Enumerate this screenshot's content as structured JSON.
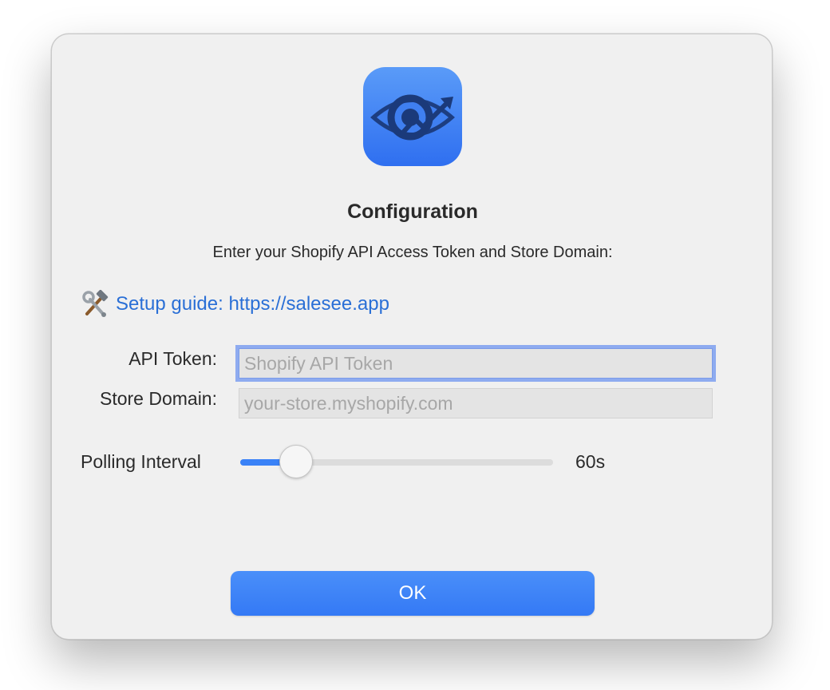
{
  "dialog": {
    "title": "Configuration",
    "subtitle": "Enter your Shopify API Access Token and Store Domain:",
    "app_icon": "eye-chart-app-icon",
    "guide": {
      "icon": "hammer-wrench-icon",
      "link_text": "Setup guide: https://salesee.app"
    },
    "fields": {
      "api_token": {
        "label": "API Token:",
        "value": "",
        "placeholder": "Shopify API Token"
      },
      "store_domain": {
        "label": "Store Domain:",
        "value": "",
        "placeholder": "your-store.myshopify.com"
      }
    },
    "polling": {
      "label": "Polling Interval",
      "value_text": "60s",
      "slider_fraction": 0.14
    },
    "ok_label": "OK"
  },
  "colors": {
    "accent": "#3a82f7",
    "link": "#2a6fd6",
    "dialog_bg": "#f0f0f0"
  }
}
